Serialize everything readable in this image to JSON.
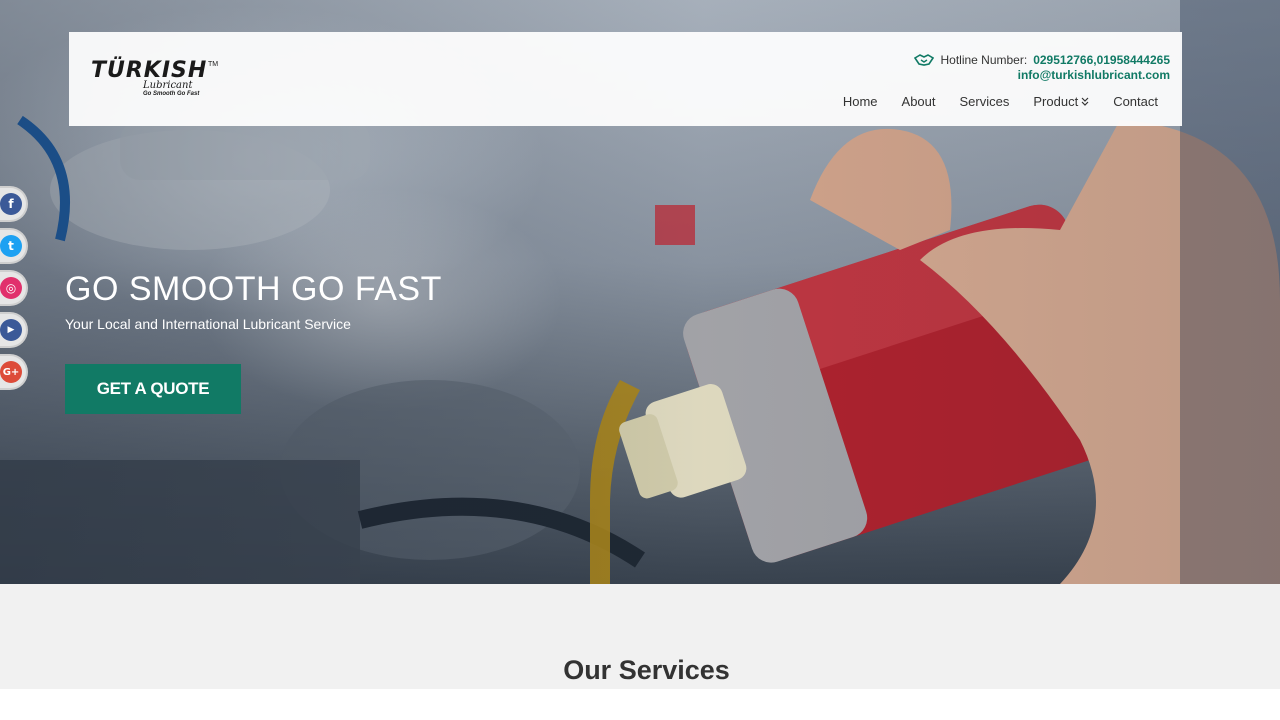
{
  "header": {
    "logo": {
      "word": "TÜRKISH",
      "tm": "TM",
      "sub": "Lubricant",
      "tagline": "Go Smooth Go Fast"
    },
    "hotline_label": "Hotline Number:",
    "hotline_value": "029512766,01958444265",
    "email": "info@turkishlubricant.com",
    "nav": [
      {
        "label": "Home"
      },
      {
        "label": "About"
      },
      {
        "label": "Services"
      },
      {
        "label": "Product"
      },
      {
        "label": "Contact"
      }
    ]
  },
  "social": [
    {
      "icon": "facebook-icon",
      "glyph": "f",
      "color": "#3b5998"
    },
    {
      "icon": "twitter-icon",
      "glyph": "t",
      "color": "#1da1f2"
    },
    {
      "icon": "instagram-icon",
      "glyph": "◎",
      "color": "#e1306c"
    },
    {
      "icon": "youtube-icon",
      "glyph": "▶",
      "color": "#3b5998"
    },
    {
      "icon": "google-plus-icon",
      "glyph": "G+",
      "color": "#dd4b39"
    }
  ],
  "hero": {
    "title": "GO SMOOTH GO FAST",
    "subtitle": "Your Local and International Lubricant Service",
    "cta": "GET A QUOTE"
  },
  "services": {
    "title": "Our Services"
  },
  "colors": {
    "brand": "#117a65",
    "text": "#333333",
    "background": "#f1f1f1"
  }
}
